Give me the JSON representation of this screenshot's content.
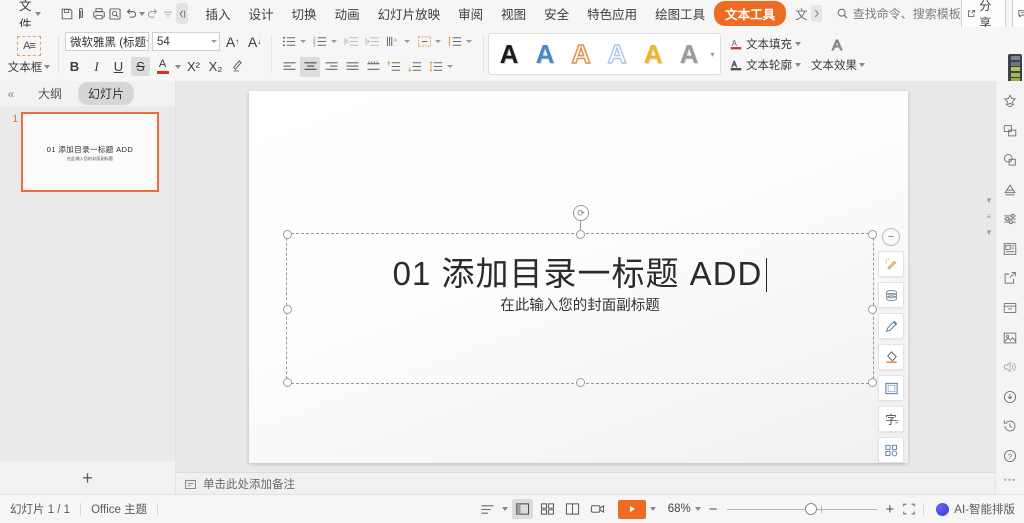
{
  "menubar": {
    "file_label": "文件",
    "quick_icons": [
      "save-icon",
      "save-as-icon",
      "print-icon",
      "print-preview-icon",
      "undo-icon",
      "redo-icon",
      "customize-icon",
      "more-icon"
    ],
    "tabs": [
      {
        "label": "插入",
        "active": false
      },
      {
        "label": "设计",
        "active": false
      },
      {
        "label": "切换",
        "active": false
      },
      {
        "label": "动画",
        "active": false
      },
      {
        "label": "幻灯片放映",
        "active": false
      },
      {
        "label": "审阅",
        "active": false
      },
      {
        "label": "视图",
        "active": false
      },
      {
        "label": "安全",
        "active": false
      },
      {
        "label": "特色应用",
        "active": false
      },
      {
        "label": "绘图工具",
        "active": false
      },
      {
        "label": "文本工具",
        "active": true
      },
      {
        "label": "文",
        "active": false,
        "clipped": true
      }
    ],
    "search_placeholder": "查找命令、搜索模板",
    "share_label": "分享",
    "comment_label": "批注",
    "help_icon": "question-icon",
    "more_icon": "more-vertical-icon",
    "collapse_icon": "chevron-up-icon",
    "accent_color": "#ec6c24"
  },
  "ribbon": {
    "textbox_group": {
      "label": "文本框"
    },
    "font_group": {
      "font_name": "微软雅黑 (标题",
      "font_size": "54",
      "grow_label": "A",
      "shrink_label": "A",
      "bold": "B",
      "italic": "I",
      "underline": "U",
      "strikethrough": "S",
      "font_color": "A",
      "superscript": "X²",
      "subscript": "X₂",
      "clear_format": "clear-format-icon",
      "strikethrough_active": true
    },
    "paragraph_group": {
      "row1": [
        "bullet-list-icon",
        "number-list-icon",
        "decrease-indent-icon",
        "increase-indent-icon",
        "text-direction-icon",
        "align-text-icon",
        "column-spacing-icon"
      ],
      "row2": [
        "align-left-icon",
        "align-center-icon",
        "align-right-icon",
        "justify-icon",
        "distribute-icon",
        "paragraph-space-before-icon",
        "paragraph-space-after-icon",
        "line-spacing-icon"
      ],
      "active": "align-center-icon"
    },
    "wordart_group": {
      "styles": [
        {
          "name": "wordart-black",
          "color": "#1a1a1a",
          "outline": false
        },
        {
          "name": "wordart-blue",
          "color": "#4a86c8",
          "outline": false
        },
        {
          "name": "wordart-orange-outline",
          "color": "#e09350",
          "outline": true
        },
        {
          "name": "wordart-lightblue-outline",
          "color": "#a8c8e8",
          "outline": true
        },
        {
          "name": "wordart-yellow",
          "color": "#f0b429",
          "outline": false
        },
        {
          "name": "wordart-gray",
          "color": "#9a9a9a",
          "outline": false
        }
      ],
      "sample_glyph": "A",
      "text_fill_label": "文本填充",
      "text_outline_label": "文本轮廓",
      "text_effect_label": "文本效果"
    }
  },
  "left_panel": {
    "collapse_icon": "chevron-double-left-icon",
    "tab_outline": "大纲",
    "tab_slides": "幻灯片",
    "active_tab": "幻灯片",
    "slides": [
      {
        "number": "1",
        "title": "01 添加目录一标题 ADD",
        "subtitle": "在此输入您的封面副标题",
        "selected": true
      }
    ],
    "add_slide_icon": "plus-icon"
  },
  "canvas": {
    "slide": {
      "title": "01 添加目录一标题 ADD",
      "subtitle": "在此输入您的封面副标题",
      "selected": true,
      "rotate_handle": "rotate-icon"
    },
    "notes_placeholder": "单击此处添加备注",
    "notes_icon": "notes-icon",
    "float_tools": [
      "minimize-icon",
      "design-ideas-icon",
      "layers-icon",
      "pen-icon",
      "eraser-icon",
      "frame-icon",
      "text-format-icon",
      "smart-layout-icon"
    ]
  },
  "right_rail": {
    "icons": [
      "star-badge-icon",
      "duplicate-icon",
      "shape-icon",
      "triangle-chart-icon",
      "adjust-sliders-icon",
      "picture-frame-icon",
      "share-export-icon",
      "archive-icon",
      "image-icon",
      "audio-icon",
      "download-icon",
      "history-icon",
      "help-circle-icon"
    ],
    "more_dots": "•••"
  },
  "statusbar": {
    "slide_count": "幻灯片 1 / 1",
    "theme": "Office 主题",
    "view_icons": [
      "outline-view-icon",
      "normal-view-icon",
      "slide-sorter-icon",
      "reading-view-icon",
      "presenter-view-icon"
    ],
    "active_view": "normal-view-icon",
    "play_icon": "play-icon",
    "zoom_level": "68%",
    "zoom_out": "−",
    "zoom_in": "+",
    "fit_icon": "fit-to-window-icon",
    "ai_label": "AI-智能排版"
  }
}
